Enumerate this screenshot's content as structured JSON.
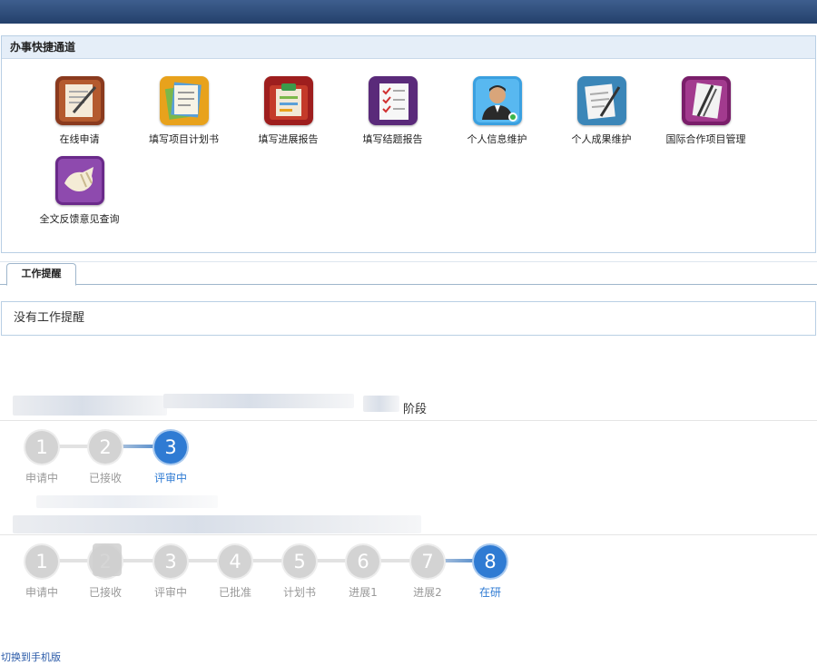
{
  "quick_access": {
    "title": "办事快捷通道",
    "items": [
      {
        "label": "在线申请",
        "icon": "online-application-icon"
      },
      {
        "label": "填写项目计划书",
        "icon": "project-plan-icon"
      },
      {
        "label": "填写进展报告",
        "icon": "progress-report-icon"
      },
      {
        "label": "填写结题报告",
        "icon": "final-report-icon"
      },
      {
        "label": "个人信息维护",
        "icon": "user-profile-icon"
      },
      {
        "label": "个人成果维护",
        "icon": "achievements-icon"
      },
      {
        "label": "国际合作项目管理",
        "icon": "international-project-icon"
      },
      {
        "label": "全文反馈意见查询",
        "icon": "feedback-query-icon"
      }
    ]
  },
  "work_reminder": {
    "tab_label": "工作提醒",
    "message": "没有工作提醒"
  },
  "projects": [
    {
      "title_suffix": "阶段",
      "steps": [
        {
          "num": "1",
          "label": "申请中"
        },
        {
          "num": "2",
          "label": "已接收"
        },
        {
          "num": "3",
          "label": "评审中"
        }
      ],
      "current_step": 3
    },
    {
      "title_suffix": "",
      "steps": [
        {
          "num": "1",
          "label": "申请中"
        },
        {
          "num": "2",
          "label": "已接收"
        },
        {
          "num": "3",
          "label": "评审中"
        },
        {
          "num": "4",
          "label": "已批准"
        },
        {
          "num": "5",
          "label": "计划书"
        },
        {
          "num": "6",
          "label": "进展1"
        },
        {
          "num": "7",
          "label": "进展2"
        },
        {
          "num": "8",
          "label": "在研"
        }
      ],
      "current_step": 8
    }
  ],
  "footer": {
    "switch_mobile": "切换到手机版"
  },
  "colors": {
    "topbar": "#2c4a78",
    "accent_blue": "#2f7bd3",
    "step_inactive": "#d3d3d3"
  }
}
